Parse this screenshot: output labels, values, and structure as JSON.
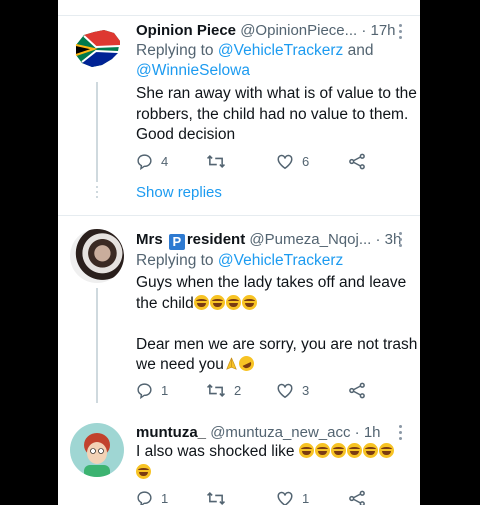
{
  "tweets": [
    {
      "name": "Opinion Piece",
      "handle": "@OpinionPiece...",
      "time": "17h",
      "reply_prefix": "Replying to ",
      "reply_to_1": "@VehicleTrackerz",
      "reply_and": " and",
      "reply_to_2": "@WinnieSelowa",
      "body_line1": "She ran away with what is of value to the",
      "body_line2": "robbers, the child had no value to them.",
      "body_line3": "Good decision",
      "replies": "4",
      "retweets": "",
      "likes": "6",
      "show_replies": "Show replies"
    },
    {
      "name_part1": "Mrs ",
      "name_badge": "P",
      "name_part2": "resident",
      "handle": "@Pumeza_Nqoj...",
      "time": "3h",
      "reply_prefix": "Replying to ",
      "reply_to_1": "@VehicleTrackerz",
      "body_line1": "Guys when the lady takes off and leave",
      "body_line2": "the child",
      "body_line3": "Dear men we are sorry, you are not trash",
      "body_line4": "we need you",
      "replies": "1",
      "retweets": "2",
      "likes": "3"
    },
    {
      "name": "muntuza_",
      "handle": "@muntuza_new_acc",
      "time": "1h",
      "body_line1": "I also was shocked like",
      "replies": "1",
      "retweets": "",
      "likes": "1"
    }
  ],
  "dot": "·",
  "icons": [
    "more-vertical-icon",
    "reply-icon",
    "retweet-icon",
    "like-icon",
    "share-icon",
    "face-with-tears-of-joy-emoji",
    "folded-hands-emoji",
    "rolling-laughing-emoji",
    "south-africa-map-icon"
  ],
  "colors": {
    "link": "#1d9bf0",
    "text": "#0f1419",
    "muted": "#536471",
    "separator": "#e6ecf0"
  }
}
